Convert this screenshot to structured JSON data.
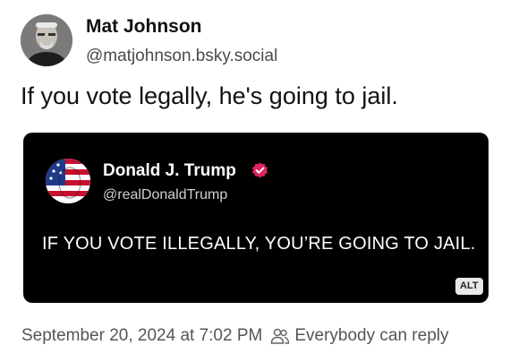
{
  "author": {
    "name": "Mat Johnson",
    "handle": "@matjohnson.bsky.social",
    "avatar_icon": "user-photo-avatar"
  },
  "post": {
    "text": "If you vote legally, he's going to jail."
  },
  "quoted_post": {
    "author_name": "Donald J. Trump",
    "author_handle": "@realDonaldTrump",
    "verified": true,
    "verified_color": "#e0245e",
    "avatar_icon": "flag-face-avatar",
    "text": "IF YOU VOTE ILLEGALLY, YOU’RE GOING TO JAIL.",
    "background": "#000000"
  },
  "alt_badge": {
    "label": "ALT"
  },
  "meta": {
    "timestamp": "September 20, 2024 at 7:02 PM",
    "reply_icon": "people-icon",
    "reply_setting": "Everybody can reply"
  }
}
